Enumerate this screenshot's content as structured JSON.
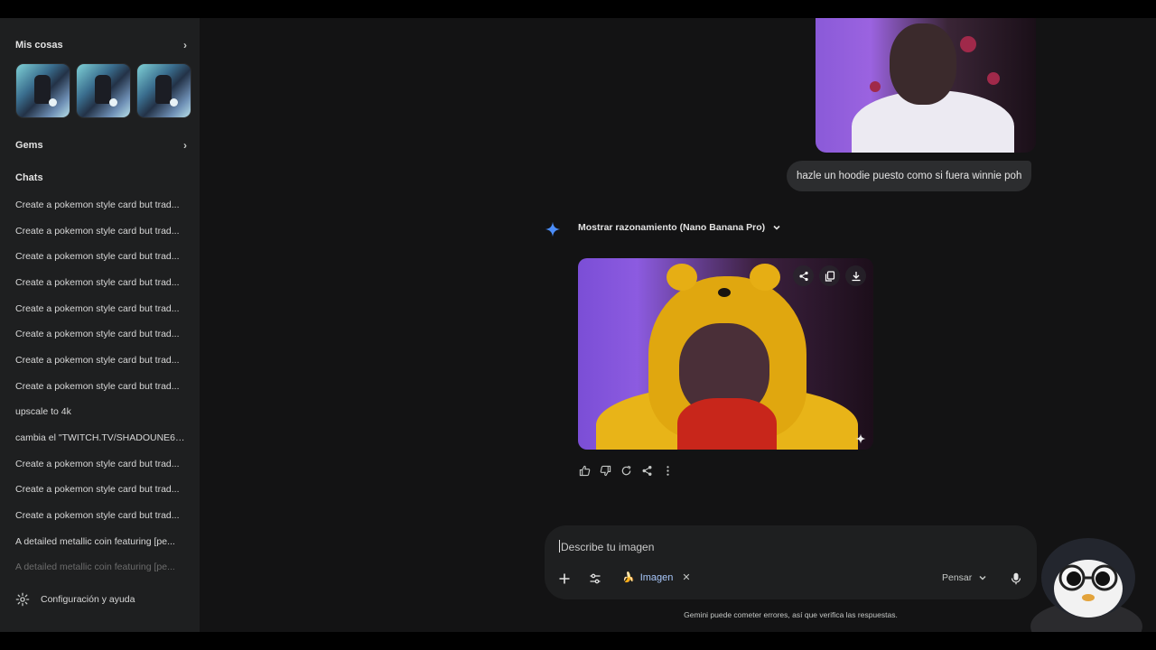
{
  "sidebar": {
    "my_stuff": "Mis cosas",
    "gems": "Gems",
    "chats_heading": "Chats",
    "chats": [
      "Create a pokemon style card but trad...",
      "Create a pokemon style card but trad...",
      "Create a pokemon style card but trad...",
      "Create a pokemon style card but trad...",
      "Create a pokemon style card but trad...",
      "Create a pokemon style card but trad...",
      "Create a pokemon style card but trad...",
      "Create a pokemon style card but trad...",
      "upscale to 4k",
      "cambia el \"TWITCH.TV/SHADOUNE66...",
      "Create a pokemon style card but trad...",
      "Create a pokemon style card but trad...",
      "Create a pokemon style card but trad...",
      "A detailed metallic coin featuring [pe...",
      "A detailed metallic coin featuring [pe..."
    ],
    "settings": "Configuración y ayuda"
  },
  "conversation": {
    "user_message": "hazle un hoodie puesto como si fuera winnie poh",
    "reasoning_label": "Mostrar razonamiento (Nano Banana Pro)"
  },
  "composer": {
    "placeholder": "Describe tu imagen",
    "tool_chip": "Imagen",
    "tool_chip_emoji": "🍌",
    "mode": "Pensar"
  },
  "disclaimer": "Gemini puede cometer errores, así que verifica las respuestas.",
  "colors": {
    "sidebar_bg": "#1e1f20",
    "main_bg": "#131314",
    "chip_text": "#a8c7fa",
    "gemini_star": "#4b8df8"
  },
  "icons": {
    "image_actions": [
      "share-icon",
      "copy-icon",
      "download-icon"
    ],
    "response_actions": [
      "thumbs-up-icon",
      "thumbs-down-icon",
      "regenerate-icon",
      "share-icon",
      "more-icon"
    ]
  }
}
